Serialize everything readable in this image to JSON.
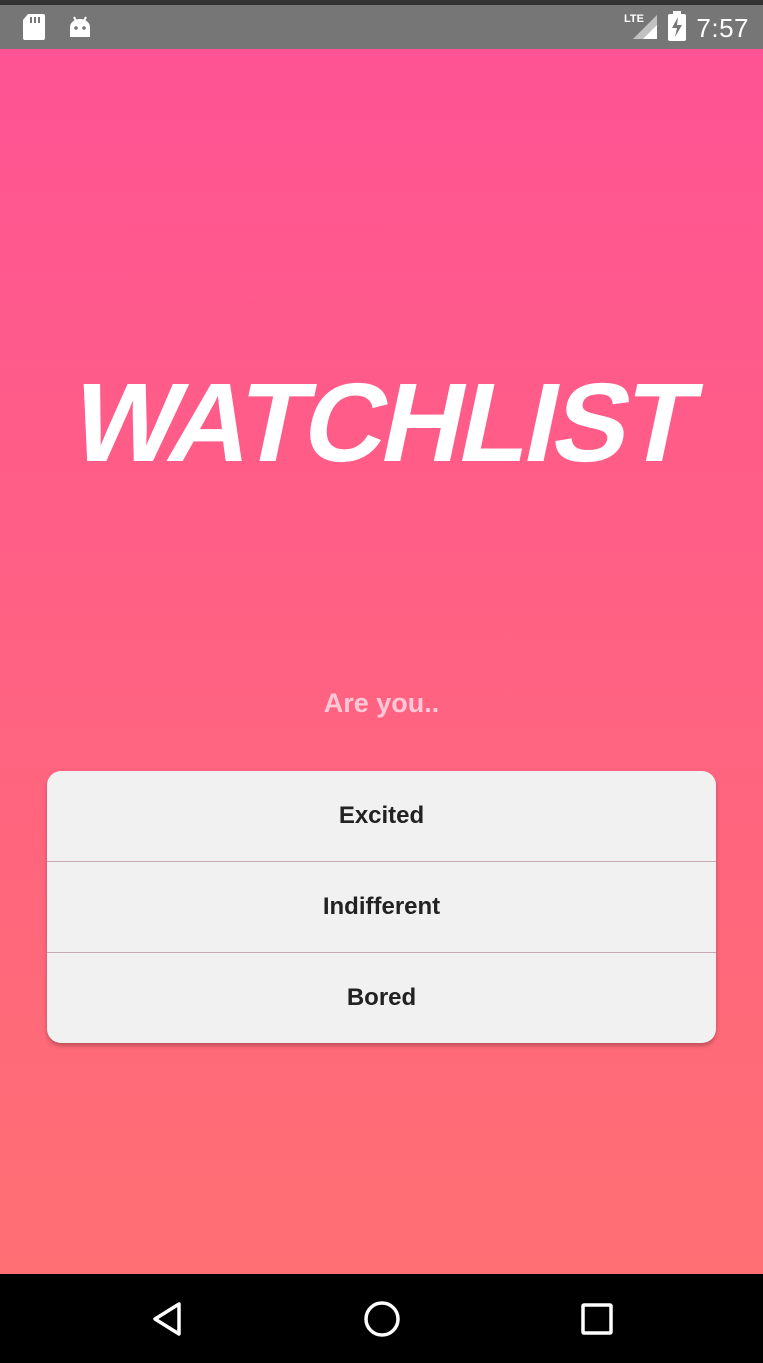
{
  "status_bar": {
    "time": "7:57",
    "network": "LTE",
    "icons": [
      "sd-card-icon",
      "android-icon",
      "lte-signal-icon",
      "battery-charging-icon"
    ]
  },
  "app": {
    "title": "WATCHLIST",
    "prompt": "Are you..",
    "choices": [
      {
        "label": "Excited"
      },
      {
        "label": "Indifferent"
      },
      {
        "label": "Bored"
      }
    ]
  },
  "navigation": {
    "icons": [
      "back-icon",
      "home-icon",
      "recents-icon"
    ]
  },
  "colors": {
    "gradient_top": "#ff5394",
    "gradient_bottom": "#ff6f73",
    "status_bar": "#767676",
    "card": "#f1f1f1",
    "prompt_text": "#ffc8d6"
  }
}
